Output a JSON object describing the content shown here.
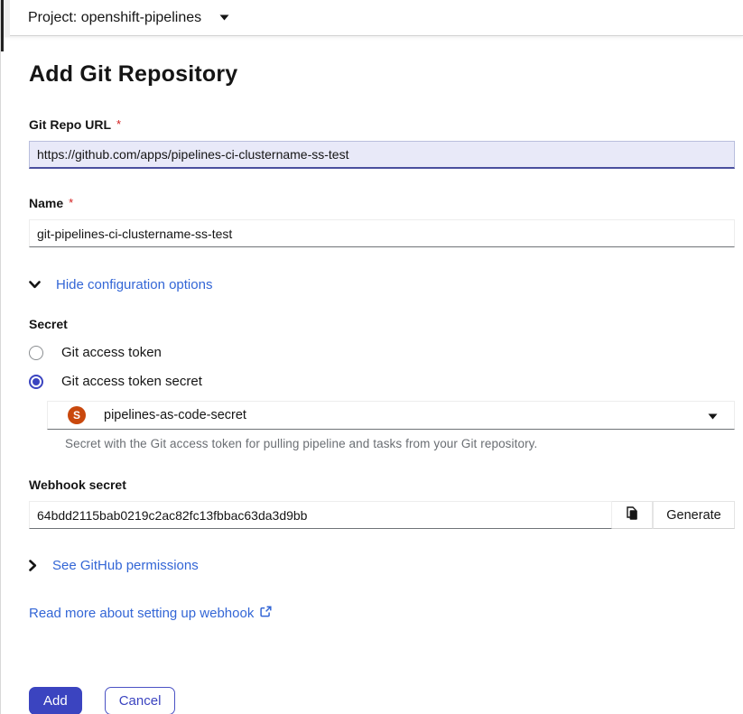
{
  "top_bar": {
    "project_label": "Project: openshift-pipelines"
  },
  "page": {
    "title": "Add Git Repository"
  },
  "form": {
    "git_repo_url": {
      "label": "Git Repo URL",
      "required_indicator": "*",
      "value": "https://github.com/apps/pipelines-ci-clustername-ss-test"
    },
    "name": {
      "label": "Name",
      "required_indicator": "*",
      "value": "git-pipelines-ci-clustername-ss-test"
    },
    "config_toggle": {
      "label": "Hide configuration options",
      "expanded": true
    },
    "secret": {
      "label": "Secret",
      "options": [
        {
          "label": "Git access token",
          "selected": false
        },
        {
          "label": "Git access token secret",
          "selected": true
        }
      ],
      "secret_select": {
        "badge": "S",
        "value": "pipelines-as-code-secret"
      },
      "help_text": "Secret with the Git access token for pulling pipeline and tasks from your Git repository."
    },
    "webhook_secret": {
      "label": "Webhook secret",
      "value": "64bdd2115bab0219c2ac82fc13fbbac63da3d9bb",
      "generate_label": "Generate"
    },
    "github_permissions_toggle": {
      "label": "See GitHub permissions",
      "expanded": false
    },
    "webhook_link": {
      "label": "Read more about setting up webhook"
    },
    "actions": {
      "add_label": "Add",
      "cancel_label": "Cancel"
    }
  },
  "colors": {
    "primary": "#3b44c0",
    "link": "#3366d6",
    "danger": "#d21c1c",
    "secret_badge": "#c9480d"
  }
}
